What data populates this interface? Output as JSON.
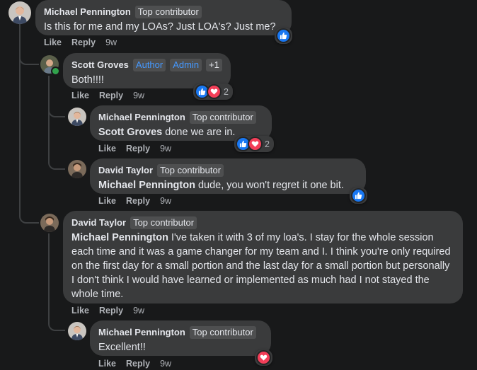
{
  "comments": [
    {
      "author": "Michael Pennington",
      "badges": [
        "Top contributor"
      ],
      "text": "Is this for me and my LOAs? Just LOA's? Just me?",
      "actions": {
        "like": "Like",
        "reply": "Reply",
        "time": "9w"
      },
      "reactions": {
        "types": [
          "like"
        ],
        "count": ""
      }
    },
    {
      "author": "Scott Groves",
      "badges": [
        "Author",
        "Admin",
        "+1"
      ],
      "text": "Both!!!!",
      "actions": {
        "like": "Like",
        "reply": "Reply",
        "time": "9w"
      },
      "reactions": {
        "types": [
          "like",
          "love"
        ],
        "count": "2"
      }
    },
    {
      "author": "Michael Pennington",
      "badges": [
        "Top contributor"
      ],
      "mention": "Scott Groves",
      "text": " done we are in.",
      "actions": {
        "like": "Like",
        "reply": "Reply",
        "time": "9w"
      },
      "reactions": {
        "types": [
          "like",
          "love"
        ],
        "count": "2"
      }
    },
    {
      "author": "David Taylor",
      "badges": [
        "Top contributor"
      ],
      "mention": "Michael Pennington",
      "text": " dude, you won't regret it one bit.",
      "actions": {
        "like": "Like",
        "reply": "Reply",
        "time": "9w"
      },
      "reactions": {
        "types": [
          "like"
        ],
        "count": ""
      }
    },
    {
      "author": "David Taylor",
      "badges": [
        "Top contributor"
      ],
      "mention": "Michael Pennington",
      "text": " I've taken it with 3 of my loa's. I stay for the whole session each time and it was a game changer for my team and I. I think you're only required on the first day for a small portion and the last day for a small portion but personally I don't think I would have learned or implemented as much had I not stayed the whole time.",
      "actions": {
        "like": "Like",
        "reply": "Reply",
        "time": "9w"
      },
      "reactions": {
        "types": [],
        "count": ""
      }
    },
    {
      "author": "Michael Pennington",
      "badges": [
        "Top contributor"
      ],
      "text": "Excellent!!",
      "actions": {
        "like": "Like",
        "reply": "Reply",
        "time": "9w"
      },
      "reactions": {
        "types": [
          "love"
        ],
        "count": ""
      }
    }
  ],
  "colors": {
    "background": "#18191a",
    "bubble": "#3a3b3c",
    "like": "#1877f2",
    "love": "#f33e58",
    "badge_blue": "#4599ff"
  },
  "icons": {
    "like": "thumbs-up-icon",
    "love": "heart-icon"
  }
}
